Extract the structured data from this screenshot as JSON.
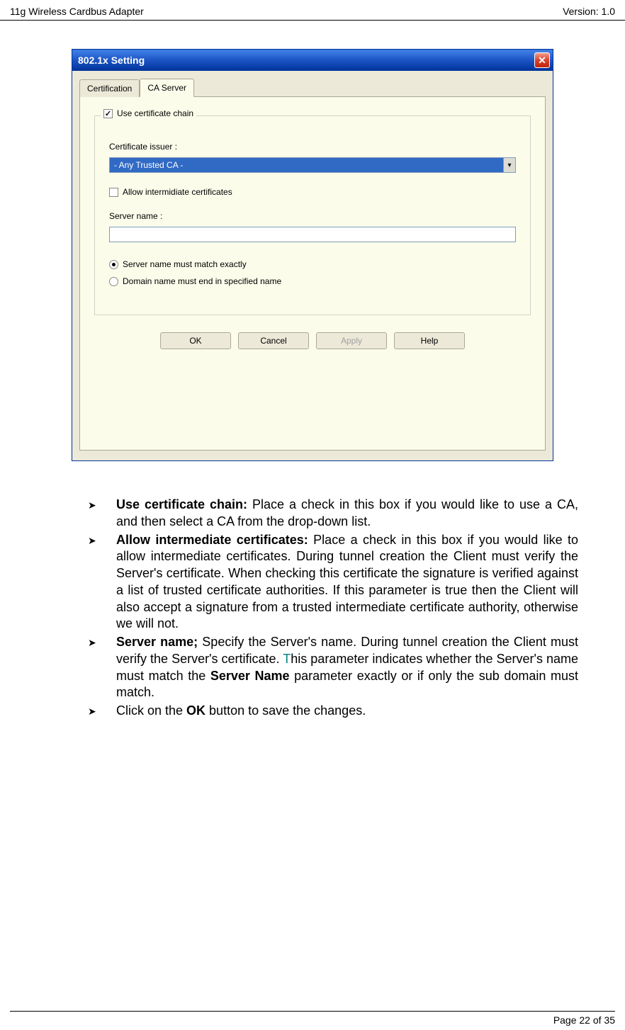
{
  "header": {
    "left": "11g Wireless Cardbus Adapter",
    "right": "Version: 1.0"
  },
  "dialog": {
    "title": "802.1x Setting",
    "tabs": {
      "certification": "Certification",
      "ca_server": "CA Server"
    },
    "groupbox_label": "Use certificate chain",
    "cert_issuer_label": "Certificate issuer :",
    "dropdown_value": "- Any Trusted CA -",
    "allow_intermid": "Allow intermidiate certificates",
    "server_name_label": "Server name :",
    "server_name_value": "",
    "radio_exact": "Server name must match exactly",
    "radio_domain": "Domain name must end in specified name",
    "buttons": {
      "ok": "OK",
      "cancel": "Cancel",
      "apply": "Apply",
      "help": "Help"
    }
  },
  "bullets": {
    "b1_lead": "Use certificate chain:",
    "b1_rest": " Place a check in this box if you would like to use a CA, and then select a CA from the drop-down list.",
    "b2_lead": "Allow intermediate certificates:",
    "b2_rest": " Place a check in this box if you would like to allow intermediate certificates. During tunnel creation the Client must verify the Server's certificate. When checking this certificate the signature is verified against a list of trusted certificate authorities. If this parameter is true then the Client will also accept a signature from a trusted intermediate certificate authority, otherwise we will not.",
    "b3_lead": "Server name;",
    "b3_rest_a": " Specify the Server's name. During tunnel creation the Client must verify the Server's certificate. ",
    "b3_t": "T",
    "b3_rest_b": "his parameter indicates whether the Server's name must match the ",
    "b3_bold": "Server Name",
    "b3_rest_c": " parameter exactly or if only the sub domain must match.",
    "b4_a": "Click on the ",
    "b4_ok": "OK",
    "b4_b": " button to save the changes."
  },
  "footer": "Page 22 of 35"
}
